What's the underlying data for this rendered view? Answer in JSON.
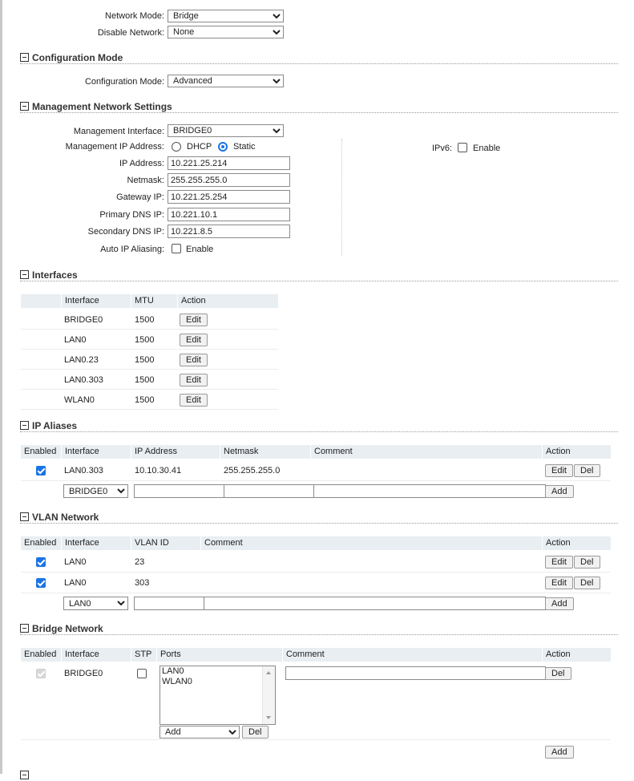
{
  "network": {
    "mode_label": "Network Mode:",
    "mode_value": "Bridge",
    "disable_label": "Disable Network:",
    "disable_value": "None"
  },
  "config_mode": {
    "section_title": "Configuration Mode",
    "label": "Configuration Mode:",
    "value": "Advanced"
  },
  "mgmt": {
    "section_title": "Management Network Settings",
    "interface_label": "Management Interface:",
    "interface_value": "BRIDGE0",
    "ip_mode_label": "Management IP Address:",
    "dhcp_label": "DHCP",
    "static_label": "Static",
    "selected_mode": "Static",
    "ip_label": "IP Address:",
    "ip_value": "10.221.25.214",
    "netmask_label": "Netmask:",
    "netmask_value": "255.255.255.0",
    "gateway_label": "Gateway IP:",
    "gateway_value": "10.221.25.254",
    "dns1_label": "Primary DNS IP:",
    "dns1_value": "10.221.10.1",
    "dns2_label": "Secondary DNS IP:",
    "dns2_value": "10.221.8.5",
    "alias_label": "Auto IP Aliasing:",
    "alias_enable_label": "Enable",
    "alias_checked": false,
    "ipv6_label": "IPv6:",
    "ipv6_enable_label": "Enable",
    "ipv6_checked": false
  },
  "interfaces": {
    "section_title": "Interfaces",
    "headers": [
      "Interface",
      "MTU",
      "Action"
    ],
    "edit_label": "Edit",
    "rows": [
      {
        "name": "BRIDGE0",
        "mtu": "1500"
      },
      {
        "name": "LAN0",
        "mtu": "1500"
      },
      {
        "name": "LAN0.23",
        "mtu": "1500"
      },
      {
        "name": "LAN0.303",
        "mtu": "1500"
      },
      {
        "name": "WLAN0",
        "mtu": "1500"
      }
    ]
  },
  "ip_aliases": {
    "section_title": "IP Aliases",
    "headers": [
      "Enabled",
      "Interface",
      "IP Address",
      "Netmask",
      "Comment",
      "Action"
    ],
    "rows": [
      {
        "enabled": true,
        "interface": "LAN0.303",
        "ip": "10.10.30.41",
        "netmask": "255.255.255.0",
        "comment": ""
      }
    ],
    "new_interface": "BRIDGE0",
    "edit_label": "Edit",
    "del_label": "Del",
    "add_label": "Add"
  },
  "vlan": {
    "section_title": "VLAN Network",
    "headers": [
      "Enabled",
      "Interface",
      "VLAN ID",
      "Comment",
      "Action"
    ],
    "rows": [
      {
        "enabled": true,
        "interface": "LAN0",
        "vlan_id": "23",
        "comment": ""
      },
      {
        "enabled": true,
        "interface": "LAN0",
        "vlan_id": "303",
        "comment": ""
      }
    ],
    "new_interface": "LAN0",
    "edit_label": "Edit",
    "del_label": "Del",
    "add_label": "Add"
  },
  "bridge": {
    "section_title": "Bridge Network",
    "headers": [
      "Enabled",
      "Interface",
      "STP",
      "Ports",
      "Comment",
      "Action"
    ],
    "rows": [
      {
        "enabled": true,
        "interface": "BRIDGE0",
        "stp": false,
        "ports": [
          "LAN0",
          "WLAN0"
        ],
        "comment": ""
      }
    ],
    "port_add_value": "Add",
    "port_del_label": "Del",
    "del_label": "Del",
    "add_label": "Add"
  },
  "colors": {
    "accent": "#1a73e8",
    "header_bg": "#e9eef2"
  }
}
